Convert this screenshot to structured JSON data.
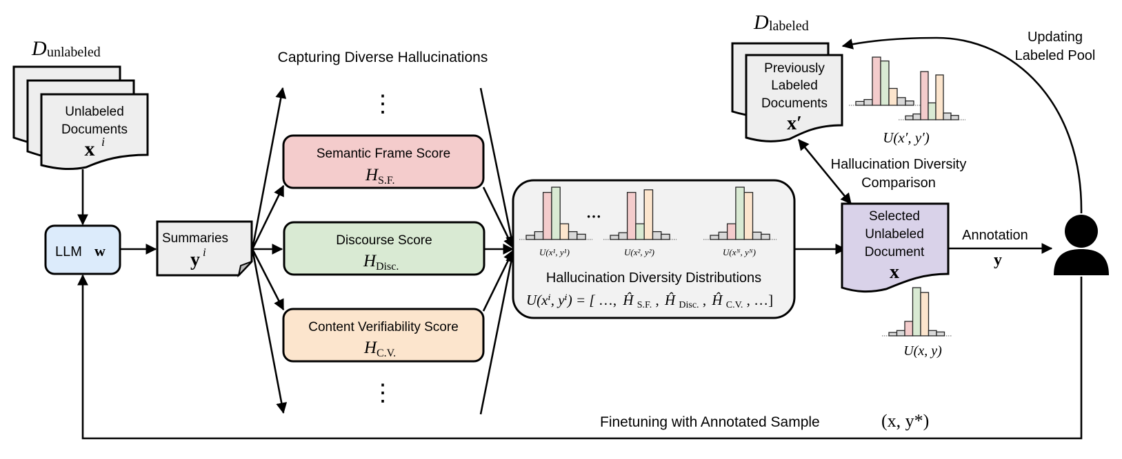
{
  "colors": {
    "llm_fill": "#dcebfb",
    "sf_fill": "#f4cccc",
    "disc_fill": "#d9ead3",
    "cv_fill": "#fce5cd",
    "dist_fill": "#f2f2f2",
    "doc_fill": "#eeeeee",
    "selected_fill": "#d9d2e9",
    "bar_gray": "#d9d9d9"
  },
  "unlabeled_pool": {
    "label_main": "D",
    "label_sub": "unlabeled",
    "doc_line1": "Unlabeled",
    "doc_line2": "Documents",
    "var": "x",
    "var_sup": "i"
  },
  "llm": {
    "label": "LLM",
    "var": "w"
  },
  "summaries": {
    "label": "Summaries",
    "var": "y",
    "var_sup": "i"
  },
  "capture": {
    "title": "Capturing Diverse Hallucinations",
    "vdots": "⋮",
    "scores": [
      {
        "name": "Semantic Frame Score",
        "sym": "H",
        "sub": "S.F."
      },
      {
        "name": "Discourse Score",
        "sym": "H",
        "sub": "Disc."
      },
      {
        "name": "Content Verifiability Score",
        "sym": "H",
        "sub": "C.V."
      }
    ]
  },
  "distributions": {
    "title": "Hallucination Diversity Distributions",
    "ellipsis": "···",
    "formula_lhs": "U(xⁱ, yⁱ) = [",
    "formula_items": [
      "…,",
      "Ĥ",
      "S.F.",
      ",",
      "Ĥ",
      "Disc.",
      ",",
      "Ĥ",
      "C.V.",
      ", …]"
    ],
    "histograms": [
      {
        "label": "U(x¹, y¹)",
        "values": [
          0.08,
          0.15,
          0.9,
          1.0,
          0.3,
          0.15,
          0.1
        ]
      },
      {
        "label": "U(x², y²)",
        "values": [
          0.08,
          0.13,
          0.9,
          0.3,
          0.95,
          0.15,
          0.1
        ]
      },
      {
        "label": "U(xᴺ, yᴺ)",
        "values": [
          0.08,
          0.14,
          0.3,
          1.0,
          0.9,
          0.14,
          0.1
        ]
      }
    ]
  },
  "labeled_pool": {
    "label_main": "D",
    "label_sub": "labeled",
    "doc_line1": "Previously",
    "doc_line2": "Labeled",
    "doc_line3": "Documents",
    "var": "x′",
    "hist_label": "U(x′, y′)",
    "histograms": [
      {
        "values": [
          0.08,
          0.12,
          1.0,
          0.92,
          0.35,
          0.16,
          0.09
        ]
      },
      {
        "values": [
          0.08,
          0.12,
          1.0,
          0.35,
          0.93,
          0.14,
          0.09
        ]
      }
    ]
  },
  "comparison": {
    "line1": "Hallucination Diversity",
    "line2": "Comparison"
  },
  "selected": {
    "line1": "Selected",
    "line2": "Unlabeled",
    "line3": "Document",
    "var": "x",
    "hist_label": "U(x, y)",
    "histogram": {
      "values": [
        0.07,
        0.11,
        0.3,
        1.0,
        0.9,
        0.11,
        0.08
      ]
    }
  },
  "annotation": {
    "label": "Annotation",
    "var": "y"
  },
  "update": {
    "line1": "Updating",
    "line2": "Labeled Pool"
  },
  "finetune": {
    "label": "Finetuning with Annotated Sample",
    "math": "(x, y*)"
  },
  "bar_colors_order": [
    "gray",
    "gray",
    "red",
    "green",
    "orange",
    "gray",
    "gray"
  ]
}
